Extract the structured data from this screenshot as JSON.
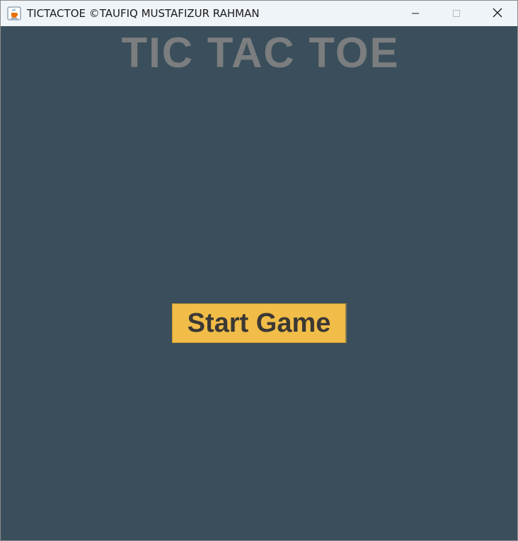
{
  "window": {
    "title": "TICTACTOE ©TAUFIQ MUSTAFIZUR RAHMAN",
    "icon": "java-cup-icon",
    "controls": [
      "minimize-icon",
      "maximize-icon",
      "close-icon"
    ]
  },
  "game": {
    "title": "TIC TAC TOE",
    "start_label": "Start Game"
  },
  "colors": {
    "background": "#3a4f5b",
    "title_text": "#7b7d7f",
    "button_bg": "#f1bc47",
    "button_text": "#3b3835",
    "titlebar": "#eff4f9"
  }
}
